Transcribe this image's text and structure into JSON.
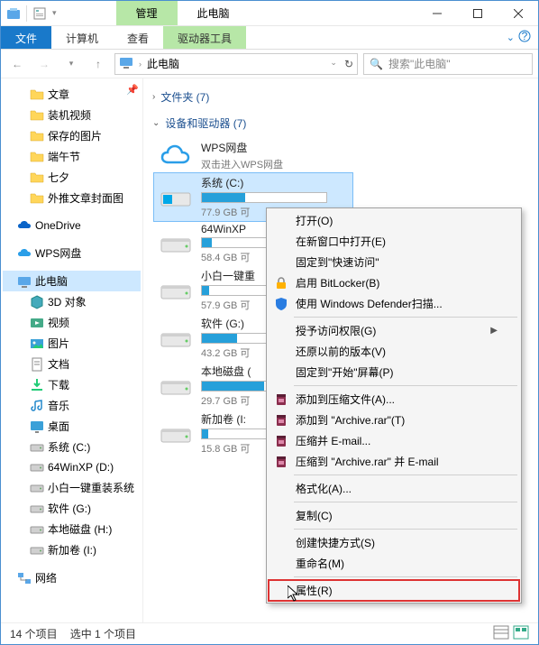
{
  "title_tabs": {
    "manage": "管理",
    "thispc": "此电脑"
  },
  "ribbon": {
    "file": "文件",
    "computer": "计算机",
    "view": "查看",
    "drivetools": "驱动器工具"
  },
  "address": {
    "path": "此电脑"
  },
  "search": {
    "placeholder": "搜索\"此电脑\""
  },
  "tree": {
    "quick": [
      {
        "label": "文章"
      },
      {
        "label": "装机视频"
      },
      {
        "label": "保存的图片"
      },
      {
        "label": "端午节"
      },
      {
        "label": "七夕"
      },
      {
        "label": "外推文章封面图"
      }
    ],
    "onedrive": "OneDrive",
    "wps": "WPS网盘",
    "thispc": "此电脑",
    "thispc_children": [
      "3D 对象",
      "视频",
      "图片",
      "文档",
      "下载",
      "音乐",
      "桌面",
      "系统 (C:)",
      "64WinXP  (D:)",
      "小白一键重装系统",
      "软件 (G:)",
      "本地磁盘 (H:)",
      "新加卷 (I:)"
    ],
    "network": "网络"
  },
  "groups": {
    "folders": "文件夹 (7)",
    "drives": "设备和驱动器 (7)"
  },
  "wps_item": {
    "name": "WPS网盘",
    "sub": "双击进入WPS网盘"
  },
  "drives": [
    {
      "name": "系统 (C:)",
      "sub": "77.9 GB 可",
      "fill": 35
    },
    {
      "name": "64WinXP",
      "sub": "58.4 GB 可",
      "fill": 8
    },
    {
      "name": "小白一键重",
      "sub": "57.9 GB 可",
      "fill": 6
    },
    {
      "name": "软件 (G:)",
      "sub": "43.2 GB 可",
      "fill": 28
    },
    {
      "name": "本地磁盘 (",
      "sub": "29.7 GB 可",
      "fill": 50
    },
    {
      "name": "新加卷 (I:",
      "sub": "15.8 GB 可",
      "fill": 5
    }
  ],
  "context_menu": [
    {
      "label": "打开(O)"
    },
    {
      "label": "在新窗口中打开(E)"
    },
    {
      "label": "固定到\"快速访问\""
    },
    {
      "label": "启用 BitLocker(B)",
      "icon": "bitlocker"
    },
    {
      "label": "使用 Windows Defender扫描...",
      "icon": "defender"
    },
    {
      "sep": true
    },
    {
      "label": "授予访问权限(G)",
      "arrow": true
    },
    {
      "label": "还原以前的版本(V)"
    },
    {
      "label": "固定到\"开始\"屏幕(P)"
    },
    {
      "sep": true
    },
    {
      "label": "添加到压缩文件(A)...",
      "icon": "rar"
    },
    {
      "label": "添加到 \"Archive.rar\"(T)",
      "icon": "rar"
    },
    {
      "label": "压缩并 E-mail...",
      "icon": "rar"
    },
    {
      "label": "压缩到 \"Archive.rar\" 并 E-mail",
      "icon": "rar"
    },
    {
      "sep": true
    },
    {
      "label": "格式化(A)..."
    },
    {
      "sep": true
    },
    {
      "label": "复制(C)"
    },
    {
      "sep": true
    },
    {
      "label": "创建快捷方式(S)"
    },
    {
      "label": "重命名(M)"
    },
    {
      "sep": true
    },
    {
      "label": "属性(R)",
      "highlight": true
    }
  ],
  "status": {
    "count": "14 个项目",
    "selected": "选中 1 个项目"
  }
}
